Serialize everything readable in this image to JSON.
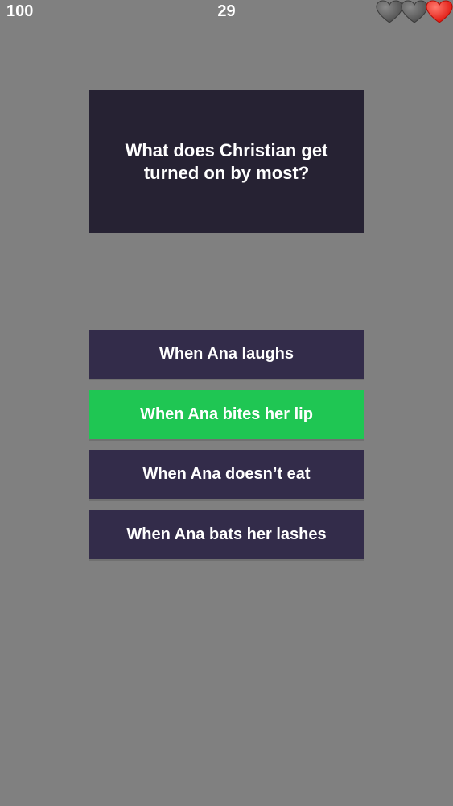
{
  "hud": {
    "score": "100",
    "question_number": "29",
    "lives": [
      {
        "state": "lost",
        "color": "#5e5e5e"
      },
      {
        "state": "lost",
        "color": "#5e5e5e"
      },
      {
        "state": "remaining",
        "color": "#ff2a1f"
      }
    ]
  },
  "question": {
    "text": "What does Christian get turned on by most?"
  },
  "answers": [
    {
      "label": "When Ana laughs",
      "state": "default"
    },
    {
      "label": "When Ana bites her lip",
      "state": "correct"
    },
    {
      "label": "When Ana doesn’t eat",
      "state": "default"
    },
    {
      "label": "When Ana bats her lashes",
      "state": "default"
    }
  ],
  "colors": {
    "background": "#808080",
    "card": "#262233",
    "answer": "#332c4a",
    "correct": "#1fc653"
  }
}
